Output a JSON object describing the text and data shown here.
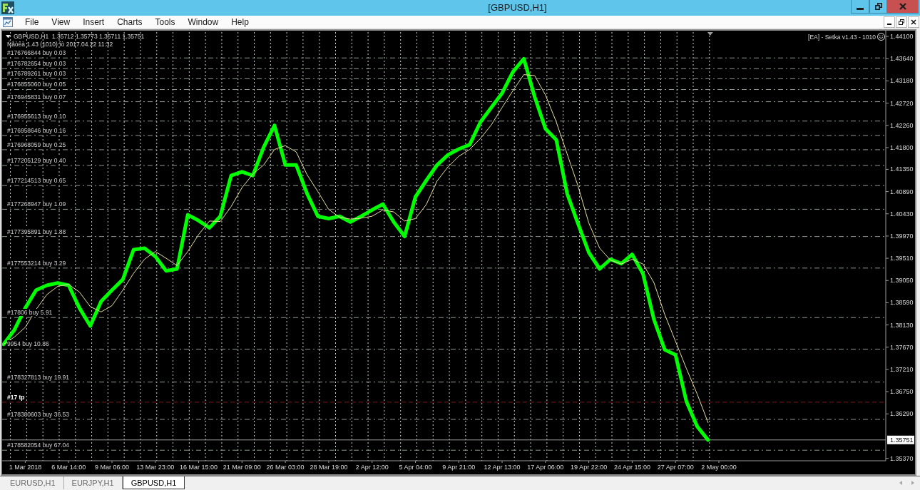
{
  "window": {
    "title": "[GBPUSD,H1]"
  },
  "menu": [
    "File",
    "View",
    "Insert",
    "Charts",
    "Tools",
    "Window",
    "Help"
  ],
  "chart": {
    "header": "GBPUSD,H1  1.35712 1.35773 1.35711 1.35751",
    "expert_info": "Ñåòêà 1.43 (1010) îò 2017.04.22 11:32",
    "expert_name": "[EA] - Setka v1.43 - 1010",
    "chart_data": [
      {
        "type": "line",
        "categories": [
          null,
          null,
          "1 Mar 2018",
          null,
          null,
          null,
          "6 Mar 14:00",
          null,
          null,
          null,
          "9 Mar 06:00",
          null,
          null,
          null,
          "13 Mar 23:00",
          null,
          null,
          null,
          "16 Mar 15:00",
          null,
          null,
          null,
          "21 Mar 09:00",
          null,
          null,
          null,
          "26 Mar 03:00",
          null,
          null,
          null,
          "28 Mar 19:00",
          null,
          null,
          null,
          "2 Apr 12:00",
          null,
          null,
          null,
          "5 Apr 04:00",
          null,
          null,
          null,
          "9 Apr 21:00",
          null,
          null,
          null,
          "12 Apr 13:00",
          null,
          null,
          null,
          "17 Apr 06:00",
          null,
          null,
          null,
          "19 Apr 22:00",
          null,
          null,
          null,
          "24 Apr 15:00",
          null,
          null,
          null,
          "27 Apr 07:00",
          null,
          null,
          null,
          "2 May 00:00"
        ],
        "series": [
          {
            "color": "#00ff00",
            "values": [
              1.3773,
              1.3803,
              1.3848,
              1.3885,
              1.3895,
              1.39,
              1.3895,
              1.3848,
              1.3811,
              1.3862,
              1.3885,
              1.3907,
              1.3969,
              1.3972,
              1.3955,
              1.3925,
              1.3929,
              1.4041,
              1.4029,
              1.4014,
              1.4038,
              1.4122,
              1.413,
              1.4122,
              1.4181,
              1.4226,
              1.4144,
              1.4144,
              1.4085,
              1.4038,
              1.4033,
              1.4038,
              1.4026,
              1.4038,
              1.4051,
              1.4063,
              1.4026,
              1.3996,
              1.4078,
              1.4112,
              1.4144,
              1.4165,
              1.4177,
              1.4186,
              1.4233,
              1.4263,
              1.4293,
              1.4337,
              1.4364,
              1.4285,
              1.4219,
              1.4196,
              1.4085,
              1.4023,
              1.3963,
              1.3929,
              1.3949,
              1.394,
              1.3959,
              1.3919,
              1.3825,
              1.3762,
              1.3751,
              1.3655,
              1.3603,
              1.3575,
              null
            ]
          },
          {
            "color": "#e8dfa0",
            "values": [
              1.3773,
              1.3788,
              1.3808,
              1.3845,
              1.3876,
              1.3893,
              1.3897,
              1.3881,
              1.3851,
              1.384,
              1.3853,
              1.3885,
              1.392,
              1.3949,
              1.3965,
              1.3951,
              1.3936,
              1.3965,
              1.4,
              1.4028,
              1.4027,
              1.4058,
              1.4097,
              1.4125,
              1.4144,
              1.4176,
              1.4184,
              1.4171,
              1.4124,
              1.4089,
              1.4052,
              1.4036,
              1.4032,
              1.4034,
              1.4038,
              1.4051,
              1.4047,
              1.4028,
              1.4033,
              1.4062,
              1.4111,
              1.414,
              1.4162,
              1.4176,
              1.4199,
              1.4227,
              1.4263,
              1.4298,
              1.4331,
              1.4329,
              1.4289,
              1.4233,
              1.4167,
              1.4101,
              1.4024,
              1.3972,
              1.3947,
              1.3939,
              1.3949,
              1.3939,
              1.3901,
              1.3835,
              1.3779,
              1.3723,
              1.367,
              1.3611,
              null
            ]
          }
        ],
        "ylim": [
          1.3532,
          1.4419
        ],
        "yticks": [
          {
            "value": 1.441,
            "label": "1.44100"
          },
          {
            "value": 1.4364,
            "label": "1.43640"
          },
          {
            "value": 1.4318,
            "label": "1.43180"
          },
          {
            "value": 1.4272,
            "label": "1.42720"
          },
          {
            "value": 1.4226,
            "label": "1.42260"
          },
          {
            "value": 1.418,
            "label": "1.41800"
          },
          {
            "value": 1.4135,
            "label": "1.41350"
          },
          {
            "value": 1.4089,
            "label": "1.40890"
          },
          {
            "value": 1.4043,
            "label": "1.40430"
          },
          {
            "value": 1.3997,
            "label": "1.39970"
          },
          {
            "value": 1.3951,
            "label": "1.39510"
          },
          {
            "value": 1.3905,
            "label": "1.39050"
          },
          {
            "value": 1.3859,
            "label": "1.38590"
          },
          {
            "value": 1.3813,
            "label": "1.38130"
          },
          {
            "value": 1.3767,
            "label": "1.37670"
          },
          {
            "value": 1.3721,
            "label": "1.37210"
          },
          {
            "value": 1.3675,
            "label": "1.36750"
          },
          {
            "value": 1.3629,
            "label": "1.36290"
          },
          {
            "value": 1.3537,
            "label": "1.35370"
          }
        ],
        "grid": true,
        "ref_lines": [
          {
            "axis": "y",
            "value": 1.43655,
            "label": "#176766844 buy 0.03",
            "color": "#8a9a8a",
            "line_style": "dashdot"
          },
          {
            "axis": "y",
            "value": 1.43432,
            "label": "#176782654 buy 0.03",
            "color": "#8a9a8a",
            "line_style": "dashdot"
          },
          {
            "axis": "y",
            "value": 1.43225,
            "label": "#176789261 buy 0.03",
            "color": "#8a9a8a",
            "line_style": "dashdot"
          },
          {
            "axis": "y",
            "value": 1.43002,
            "label": "#176855060 buy 0.05",
            "color": "#8a9a8a",
            "line_style": "dashdot"
          },
          {
            "axis": "y",
            "value": 1.4275,
            "label": "#176945831 buy 0.07",
            "color": "#8a9a8a",
            "line_style": "dashdot"
          },
          {
            "axis": "y",
            "value": 1.42349,
            "label": "#176955613 buy 0.10",
            "color": "#8a9a8a",
            "line_style": "dashdot"
          },
          {
            "axis": "y",
            "value": 1.42052,
            "label": "#176958646 buy 0.16",
            "color": "#8a9a8a",
            "line_style": "dashdot"
          },
          {
            "axis": "y",
            "value": 1.41756,
            "label": "#176968059 buy 0.25",
            "color": "#8a9a8a",
            "line_style": "dashdot"
          },
          {
            "axis": "y",
            "value": 1.41429,
            "label": "#177205129 buy 0.40",
            "color": "#8a9a8a",
            "line_style": "dashdot"
          },
          {
            "axis": "y",
            "value": 1.41014,
            "label": "#177214513 buy 0.65",
            "color": "#8a9a8a",
            "line_style": "dashdot"
          },
          {
            "axis": "y",
            "value": 1.40524,
            "label": "#177268947 buy 1.09",
            "color": "#8a9a8a",
            "line_style": "dashdot"
          },
          {
            "axis": "y",
            "value": 1.3996,
            "label": "#177395891 buy 1.88",
            "color": "#8a9a8a",
            "line_style": "dashdot"
          },
          {
            "axis": "y",
            "value": 1.39307,
            "label": "#177553214 buy 3.29",
            "color": "#8a9a8a",
            "line_style": "dashdot"
          },
          {
            "axis": "y",
            "value": 1.38283,
            "label": "#17806 buy 5.91",
            "color": "#8a9a8a",
            "line_style": "dashdot"
          },
          {
            "axis": "y",
            "value": 1.3763,
            "label": "9954 buy 10.86",
            "color": "#8a9a8a",
            "line_style": "dashdot"
          },
          {
            "axis": "y",
            "value": 1.36948,
            "label": "#178327813 buy 19.91",
            "color": "#8a9a8a",
            "line_style": "dashdot"
          },
          {
            "axis": "y",
            "value": 1.36532,
            "label": "#17 tp",
            "color": "#7a1e1e",
            "line_style": "dashed"
          },
          {
            "axis": "y",
            "value": 1.36176,
            "label": "#178380603 buy 36.53",
            "color": "#8a9a8a",
            "line_style": "dashdot"
          },
          {
            "axis": "y",
            "value": 1.35538,
            "label": "#178582054 buy 67.04",
            "color": "#8a9a8a",
            "line_style": "dashdot"
          },
          {
            "axis": "y",
            "value": 1.35751,
            "label": "1.35751",
            "color": "#9a9a9a",
            "line_style": "solid"
          }
        ]
      }
    ]
  },
  "tabs": [
    {
      "label": "EURUSD,H1",
      "selected": false
    },
    {
      "label": "EURJPY,H1",
      "selected": false
    },
    {
      "label": "GBPUSD,H1",
      "selected": true
    }
  ]
}
